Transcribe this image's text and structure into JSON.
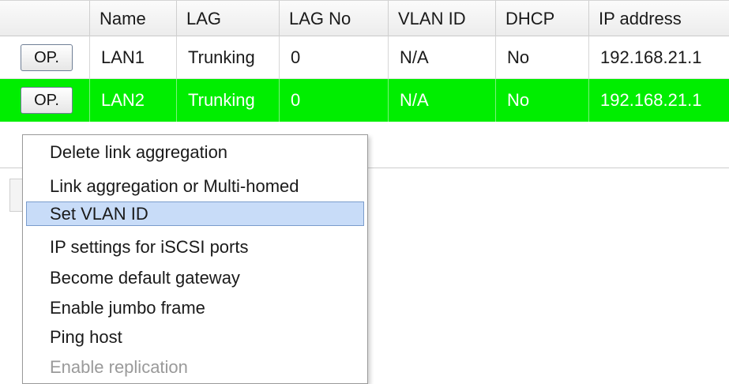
{
  "table": {
    "columns": [
      "",
      "Name",
      "LAG",
      "LAG No",
      "VLAN ID",
      "DHCP",
      "IP address"
    ],
    "rows": [
      {
        "button": "OP.",
        "name": "LAN1",
        "lag": "Trunking",
        "lag_no": "0",
        "vlan_id": "N/A",
        "dhcp": "No",
        "ip": "192.168.21.1",
        "selected": false
      },
      {
        "button": "OP.",
        "name": "LAN2",
        "lag": "Trunking",
        "lag_no": "0",
        "vlan_id": "N/A",
        "dhcp": "No",
        "ip": "192.168.21.1",
        "selected": true
      }
    ]
  },
  "context_menu": {
    "items": [
      {
        "label": "Delete link aggregation",
        "state": "normal"
      },
      {
        "label": "Link aggregation or Multi-homed",
        "state": "normal"
      },
      {
        "label": "Set VLAN ID",
        "state": "highlighted"
      },
      {
        "label": "IP settings for iSCSI ports",
        "state": "normal"
      },
      {
        "label": "Become default gateway",
        "state": "normal"
      },
      {
        "label": "Enable jumbo frame",
        "state": "normal"
      },
      {
        "label": "Ping host",
        "state": "normal"
      },
      {
        "label": "Enable replication",
        "state": "disabled"
      }
    ]
  },
  "colors": {
    "selected_row": "#00ee00",
    "menu_highlight": "#c8dcf8",
    "disabled_text": "#9a9a9a"
  }
}
